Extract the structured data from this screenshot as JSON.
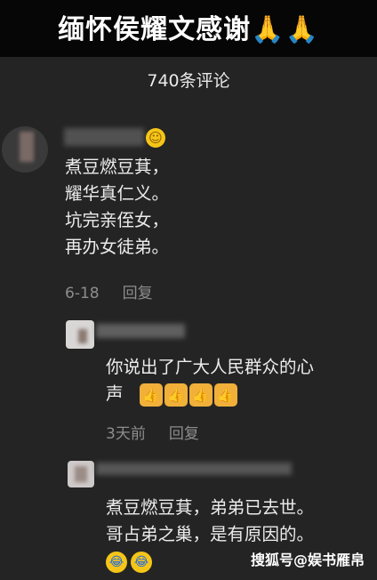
{
  "banner": {
    "title": "缅怀侯耀文感谢",
    "emoji": "🙏🙏"
  },
  "comments_header": {
    "count_label": "740条评论"
  },
  "comments": [
    {
      "lines": [
        "煮豆燃豆萁，",
        "耀华真仁义。",
        "坑完亲侄女，",
        "再办女徒弟。"
      ],
      "date": "6-18",
      "reply_label": "回复"
    },
    {
      "lines": [
        "你说出了广大人民群众的心",
        "声"
      ],
      "emoji": "👍👍👍👍",
      "date": "3天前",
      "reply_label": "回复"
    },
    {
      "lines": [
        "煮豆燃豆萁，弟弟已去世。",
        "哥占弟之巢，是有原因的。"
      ],
      "emoji": "😂😂"
    }
  ],
  "watermark": "搜狐号@娱书雁帛",
  "colors": {
    "background": "#242424",
    "banner": "#060606",
    "meta_text": "#8d8d8d"
  }
}
